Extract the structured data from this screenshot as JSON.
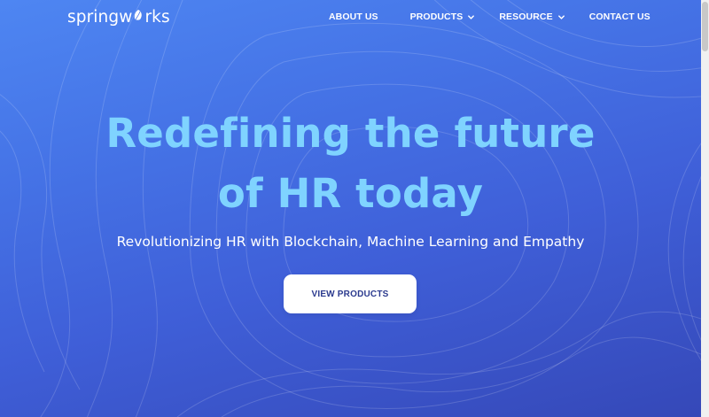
{
  "brand": {
    "logo_prefix": "springw",
    "logo_suffix": "rks",
    "logo_text": "springworks"
  },
  "nav": {
    "items": [
      {
        "label": "ABOUT US",
        "has_dropdown": false
      },
      {
        "label": "PRODUCTS",
        "has_dropdown": true
      },
      {
        "label": "RESOURCE",
        "has_dropdown": true
      },
      {
        "label": "CONTACT US",
        "has_dropdown": false
      }
    ]
  },
  "hero": {
    "headline_line1": "Redefining the future",
    "headline_line2": "of HR today",
    "subtitle": "Revolutionizing HR with Blockchain, Machine Learning and Empathy",
    "cta_label": "VIEW PRODUCTS"
  },
  "colors": {
    "headline": "#7fd3ff",
    "background_top": "#4e86f2",
    "background_bottom": "#3548b8",
    "cta_text": "#2b3a8e"
  }
}
